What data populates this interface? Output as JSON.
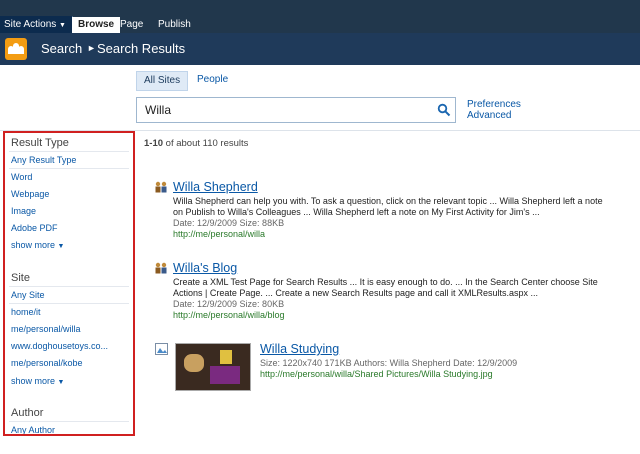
{
  "ribbon": {
    "site_actions": "Site Actions",
    "tabs": [
      "Browse",
      "Page",
      "Publish"
    ]
  },
  "breadcrumb": {
    "root": "Search",
    "current": "Search Results"
  },
  "search": {
    "scopes": [
      "All Sites",
      "People"
    ],
    "query": "Willa",
    "preferences": "Preferences",
    "advanced": "Advanced"
  },
  "refiners": {
    "result_type": {
      "heading": "Result Type",
      "items": [
        "Any Result Type",
        "Word",
        "Webpage",
        "Image",
        "Adobe PDF"
      ],
      "show_more": "show more"
    },
    "site": {
      "heading": "Site",
      "items": [
        "Any Site",
        "home/it",
        "me/personal/willa",
        "www.doghousetoys.co...",
        "me/personal/kobe"
      ],
      "show_more": "show more"
    },
    "author": {
      "heading": "Author",
      "items": [
        "Any Author"
      ]
    }
  },
  "results_summary": {
    "range": "1-10",
    "rest": " of about 110 results"
  },
  "results": [
    {
      "title": "Willa Shepherd",
      "snippet": "Willa Shepherd can help you with. To ask a question, click on the relevant topic ... Willa Shepherd left a note on Publish to Willa's Colleagues ... Willa Shepherd left a note on My First Activity for Jim's ...",
      "meta": "Date: 12/9/2009   Size: 88KB",
      "url": "http://me/personal/willa"
    },
    {
      "title": "Willa's Blog",
      "snippet": "Create a XML Test Page for Search Results ... It is easy enough to do. ... In the Search Center choose Site Actions | Create Page. ... Create a new Search Results page and call it XMLResults.aspx ...",
      "meta": "Date: 12/9/2009   Size: 80KB",
      "url": "http://me/personal/willa/blog"
    },
    {
      "title": "Willa Studying",
      "meta": "Size: 1220x740   171KB   Authors: Willa Shepherd   Date: 12/9/2009",
      "url": "http://me/personal/willa/Shared Pictures/Willa Studying.jpg"
    }
  ],
  "colors": {
    "ribbon": "#21374c",
    "titlebar": "#1f3a5a",
    "link": "#0a58a6",
    "url": "#2a7a2a",
    "highlight_border": "#d02020"
  }
}
